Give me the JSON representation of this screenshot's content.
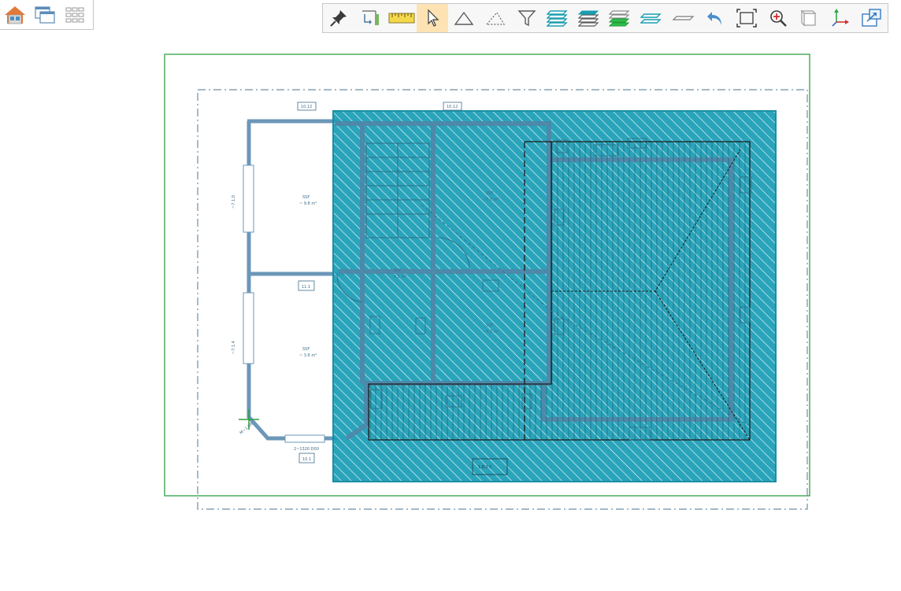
{
  "app": {
    "background": "#ffffff"
  },
  "left_toolbar": {
    "buttons": [
      {
        "name": "home-view-button",
        "icon": "house-icon"
      },
      {
        "name": "window-switch-button",
        "icon": "windows-icon"
      },
      {
        "name": "layout-grid-button",
        "icon": "grid-icon"
      }
    ]
  },
  "main_toolbar": {
    "buttons": [
      {
        "name": "pin-button",
        "icon": "pin-icon",
        "active": false
      },
      {
        "name": "dimension-corner-button",
        "icon": "dimension-corner-icon",
        "active": false
      },
      {
        "name": "measure-ruler-button",
        "icon": "ruler-icon",
        "active": false
      },
      {
        "name": "select-pointer-button",
        "icon": "cursor-icon",
        "active": true
      },
      {
        "name": "polygon-area-button",
        "icon": "triangle-icon",
        "active": false
      },
      {
        "name": "dashed-area-button",
        "icon": "dashed-triangle-icon",
        "active": false
      },
      {
        "name": "filter-button",
        "icon": "funnel-icon",
        "active": false
      },
      {
        "name": "layers-all-button",
        "icon": "layers-cyan-icon",
        "active": false
      },
      {
        "name": "layers-stack-button",
        "icon": "layers-gray-icon",
        "active": false
      },
      {
        "name": "layers-green-button",
        "icon": "layers-green-icon",
        "active": false
      },
      {
        "name": "layers-two-button",
        "icon": "layers-two-icon",
        "active": false
      },
      {
        "name": "single-plane-button",
        "icon": "plane-icon",
        "active": false
      },
      {
        "name": "undo-button",
        "icon": "undo-icon",
        "active": false
      },
      {
        "name": "zoom-extents-button",
        "icon": "fit-screen-icon",
        "active": false
      },
      {
        "name": "zoom-in-button",
        "icon": "zoom-in-icon",
        "active": false
      },
      {
        "name": "view-3d-box-button",
        "icon": "box-icon",
        "active": false
      },
      {
        "name": "axes-button",
        "icon": "axes-icon",
        "active": false
      },
      {
        "name": "export-view-button",
        "icon": "export-icon",
        "active": false
      }
    ]
  },
  "drawing": {
    "colors": {
      "border_green": "#2ea043",
      "dash_frame": "#6f8da3",
      "wall": "#6b97b8",
      "roof_fill": "#1fa0b8",
      "roof_stroke": "#0f8aa0",
      "black_line": "#1a1a1a"
    },
    "labels": {
      "top_dim_left": "10.12",
      "top_dim_right": "10.12",
      "room_upper_left_name": "SSF",
      "room_upper_left_area": "~ 9.8 m²",
      "room_lower_left_name": "SSF",
      "room_lower_left_area": "~ 3.6 m²",
      "room_mid_name": "SSF",
      "room_mid_area": "4.1 m²",
      "room_right_upper_name": "SSF",
      "room_right_upper_area": "~5.0 m²",
      "room_right_lower_name": "SSF",
      "room_right_lower_area": "~4.3 m²",
      "bottom_dim": "2~1320 D00",
      "bottom_box": "1.8.2 C",
      "small_box_mid": "11.1",
      "small_box_bottom": "10.1",
      "left_dim_upper": "~7.1.0",
      "left_dim_lower": "~7.1.4",
      "corner_tag": "M~1.0R"
    }
  }
}
